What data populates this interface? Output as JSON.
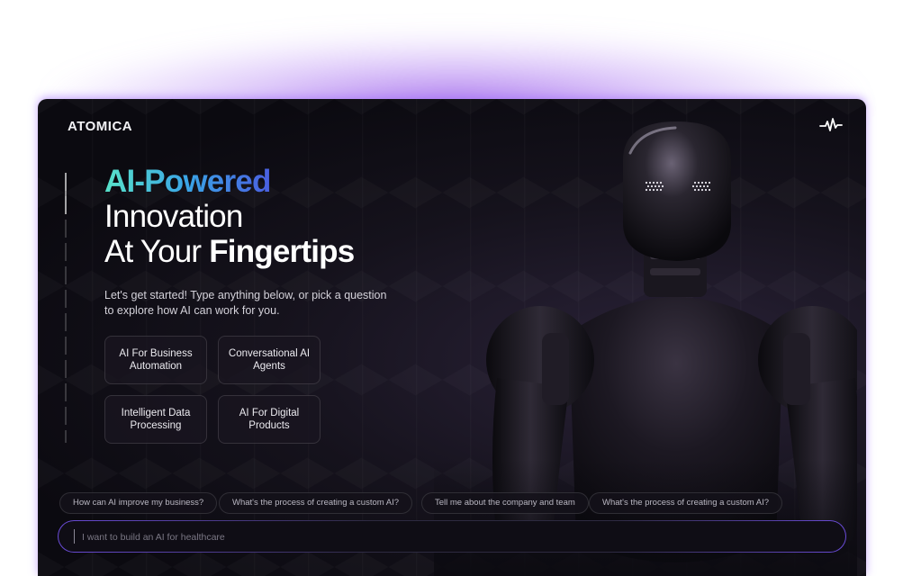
{
  "brand": {
    "name": "ATOMICA",
    "icon": "pulse-icon"
  },
  "hero": {
    "headline_gradient": "AI-Powered",
    "headline_line2": "Innovation",
    "headline_line3_regular": "At Your ",
    "headline_line3_bold": "Fingertips",
    "subtitle_line1": "Let's get started! Type anything below, or pick a question",
    "subtitle_line2": "to explore how AI can work for you."
  },
  "topics": [
    {
      "label": "AI For Business Automation"
    },
    {
      "label": "Conversational AI Agents"
    },
    {
      "label": "Intelligent Data Processing"
    },
    {
      "label": "AI For Digital Products"
    }
  ],
  "suggestions": [
    {
      "label": "How can AI improve my business?"
    },
    {
      "label": "What's the process of creating a custom AI?"
    },
    {
      "label": "Tell me about the company and team"
    },
    {
      "label": "What's the process of creating a custom AI?"
    }
  ],
  "chat": {
    "placeholder": "I want to build an AI for healthcare"
  },
  "colors": {
    "accent_purple": "#8c46e6",
    "gradient_start": "#58e2c9",
    "gradient_end": "#4a5fe0",
    "card_bg": "#0b0a10"
  }
}
